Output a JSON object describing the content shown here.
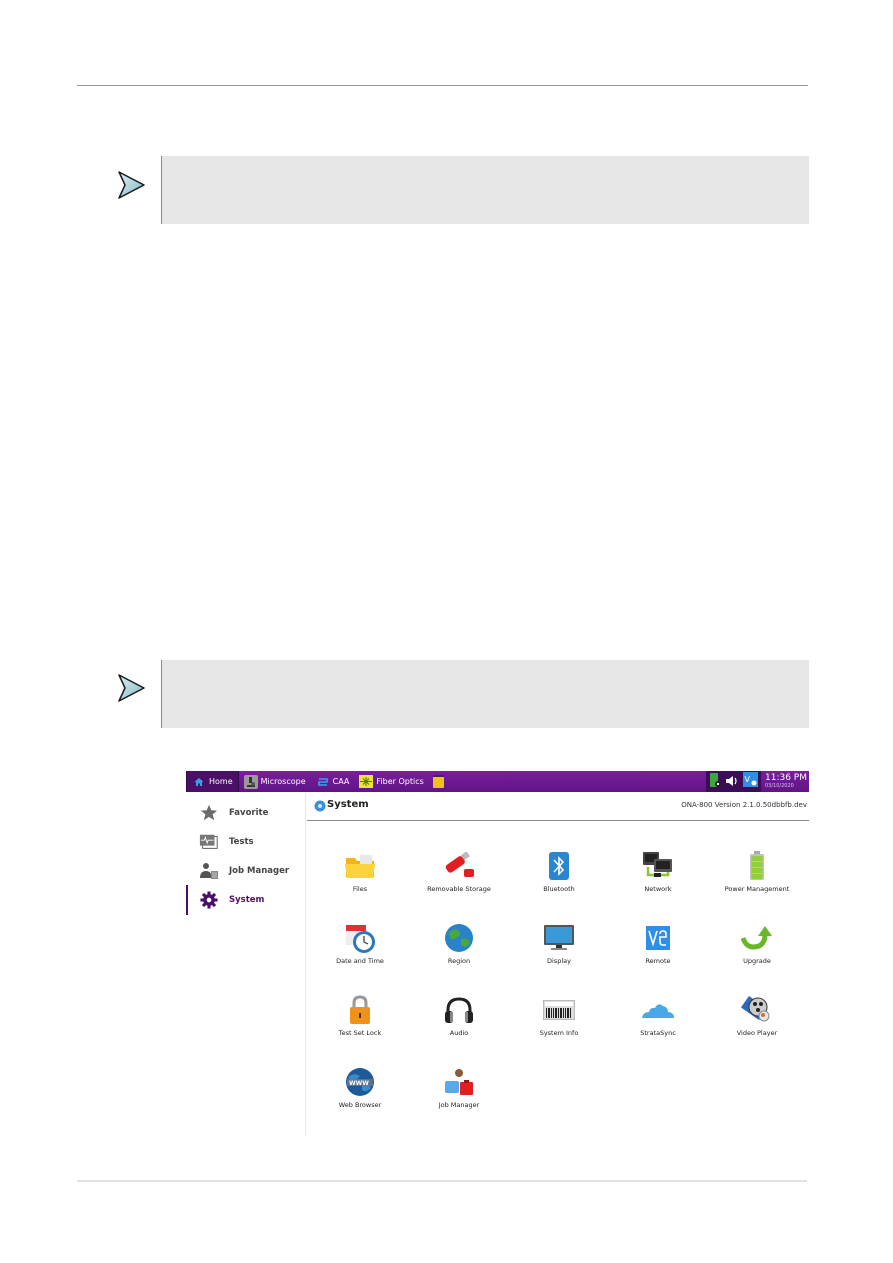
{
  "page": {
    "notes": [
      {
        "icon": "note-arrow-icon",
        "text": ""
      },
      {
        "icon": "note-arrow-icon",
        "text": ""
      }
    ]
  },
  "device": {
    "topbar": {
      "tabs": [
        {
          "label": "Home",
          "icon": "home-icon",
          "active": true
        },
        {
          "label": "Microscope",
          "icon": "microscope-icon",
          "active": false
        },
        {
          "label": "CAA",
          "icon": "caa-icon",
          "active": false
        },
        {
          "label": "Fiber Optics",
          "icon": "fiber-optics-icon",
          "active": false
        }
      ],
      "status": {
        "battery_icon": "battery-plug-icon",
        "volume_icon": "volume-icon",
        "remote_icon": "vnc-remote-icon",
        "time": "11:36 PM",
        "date": "03/10/2020"
      }
    },
    "sidebar": {
      "items": [
        {
          "label": "Favorite",
          "icon": "star-icon",
          "active": false
        },
        {
          "label": "Tests",
          "icon": "tests-icon",
          "active": false
        },
        {
          "label": "Job Manager",
          "icon": "job-manager-icon",
          "active": false
        },
        {
          "label": "System",
          "icon": "gear-icon",
          "active": true
        }
      ]
    },
    "content": {
      "title": "System",
      "version": "ONA-800 Version 2.1.0.50dbbfb.dev",
      "apps": [
        {
          "label": "Files",
          "icon": "folder-icon"
        },
        {
          "label": "Removable Storage",
          "icon": "usb-drive-icon"
        },
        {
          "label": "Bluetooth",
          "icon": "bluetooth-icon"
        },
        {
          "label": "Network",
          "icon": "network-icon"
        },
        {
          "label": "Power Management",
          "icon": "battery-icon"
        },
        {
          "label": "Date and Time",
          "icon": "calendar-clock-icon"
        },
        {
          "label": "Region",
          "icon": "globe-icon"
        },
        {
          "label": "Display",
          "icon": "monitor-icon"
        },
        {
          "label": "Remote",
          "icon": "vnc-icon"
        },
        {
          "label": "Upgrade",
          "icon": "upgrade-arrow-icon"
        },
        {
          "label": "Test Set Lock",
          "icon": "padlock-icon"
        },
        {
          "label": "Audio",
          "icon": "headphones-icon"
        },
        {
          "label": "System Info",
          "icon": "barcode-icon"
        },
        {
          "label": "StrataSync",
          "icon": "cloud-icon"
        },
        {
          "label": "Video Player",
          "icon": "video-player-icon"
        },
        {
          "label": "Web Browser",
          "icon": "www-globe-icon"
        },
        {
          "label": "Job Manager",
          "icon": "job-manager-person-icon"
        }
      ]
    }
  }
}
